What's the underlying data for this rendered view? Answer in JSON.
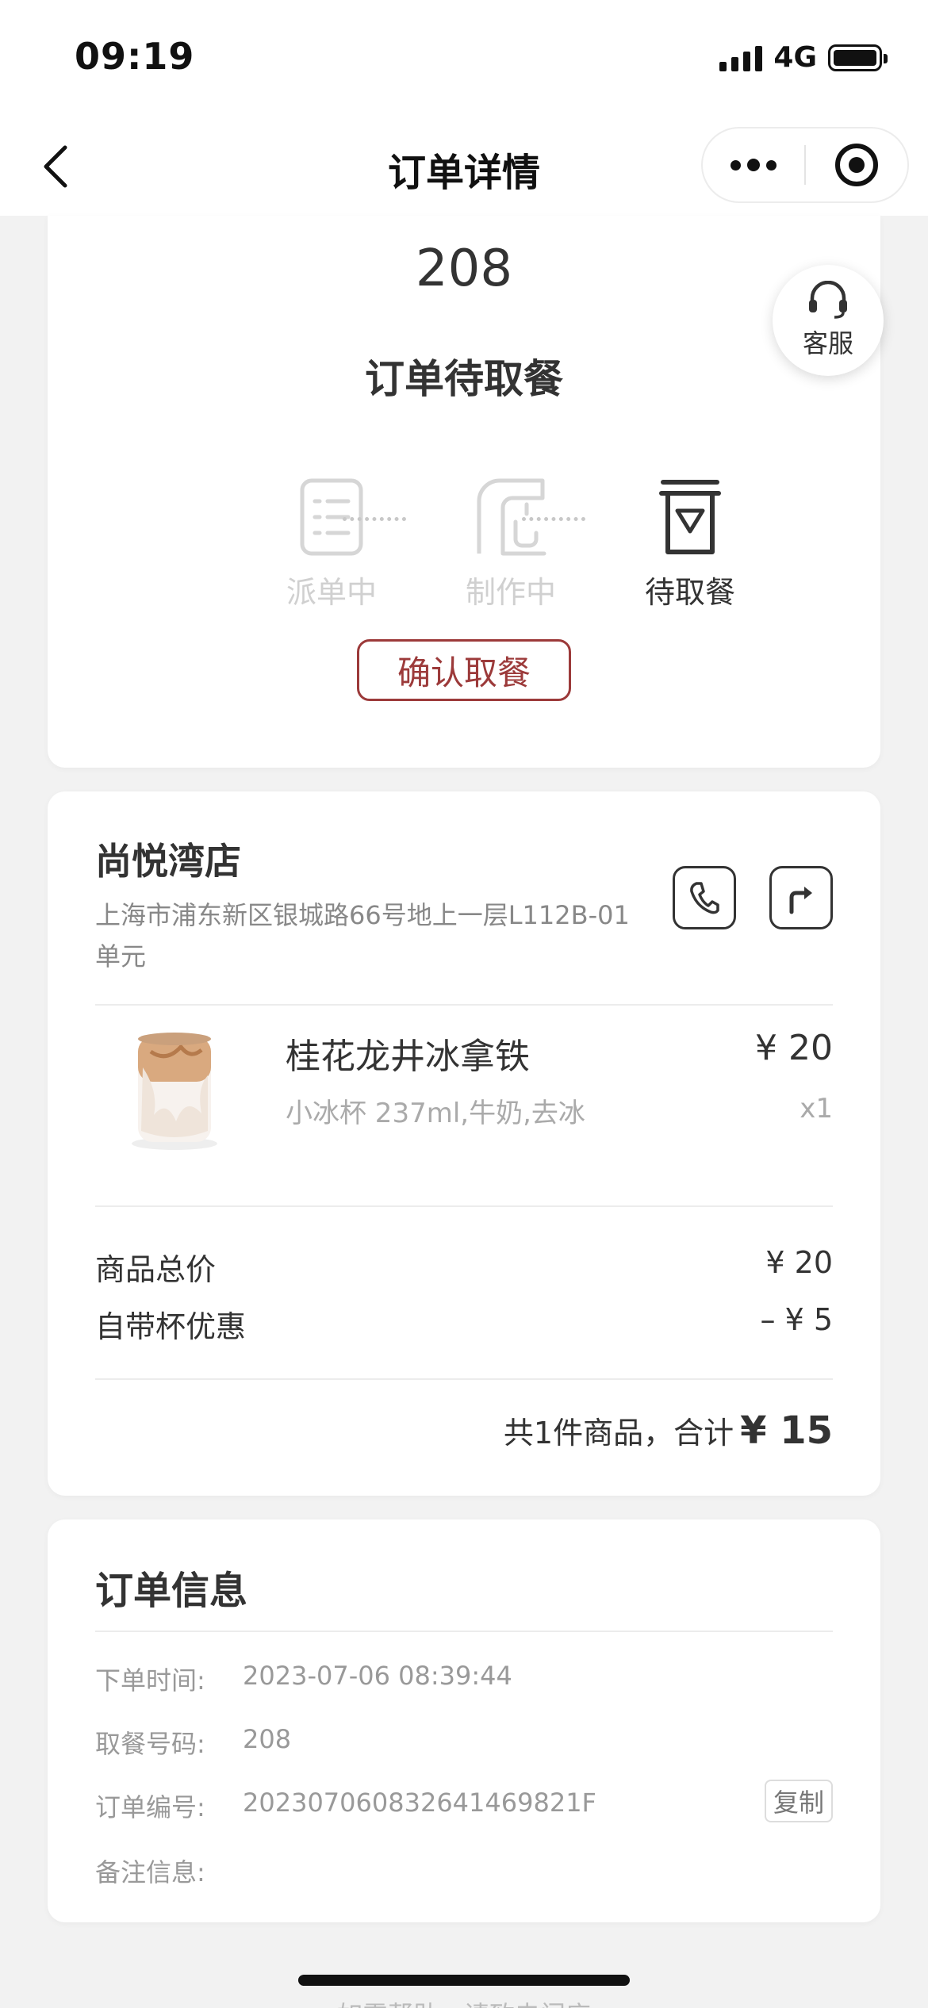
{
  "status_bar": {
    "time": "09:19",
    "network": "4G"
  },
  "nav": {
    "title": "订单详情"
  },
  "order": {
    "pickup_number": "208",
    "status_text": "订单待取餐",
    "support_label": "客服",
    "steps": [
      {
        "label": "派单中",
        "state": "done",
        "icon": "order-list-icon"
      },
      {
        "label": "制作中",
        "state": "done",
        "icon": "coffee-machine-icon"
      },
      {
        "label": "待取餐",
        "state": "active",
        "icon": "cup-icon"
      }
    ],
    "confirm_label": "确认取餐"
  },
  "store": {
    "name": "尚悦湾店",
    "address": "上海市浦东新区银城路66号地上一层L112B-01单元"
  },
  "product": {
    "name": "桂花龙井冰拿铁",
    "spec": "小冰杯 237ml,牛奶,去冰",
    "price": "¥ 20",
    "qty": "x1"
  },
  "summary": {
    "subtotal_label": "商品总价",
    "subtotal_value": "¥ 20",
    "discount_label": "自带杯优惠",
    "discount_value": "–  ¥ 5",
    "total_prefix": "共1件商品，合计",
    "total_amount": "¥ 15"
  },
  "info": {
    "title": "订单信息",
    "rows": [
      {
        "label": "下单时间:",
        "value": "2023-07-06 08:39:44"
      },
      {
        "label": "取餐号码:",
        "value": "208"
      },
      {
        "label": "订单编号:",
        "value": "202307060832641469821F"
      },
      {
        "label": "备注信息:",
        "value": ""
      }
    ],
    "copy_label": "复制"
  },
  "footer": {
    "help_text": "如需帮助，请致电门店"
  },
  "colors": {
    "accent": "#9c3a3a",
    "background": "#f2f2f2"
  }
}
